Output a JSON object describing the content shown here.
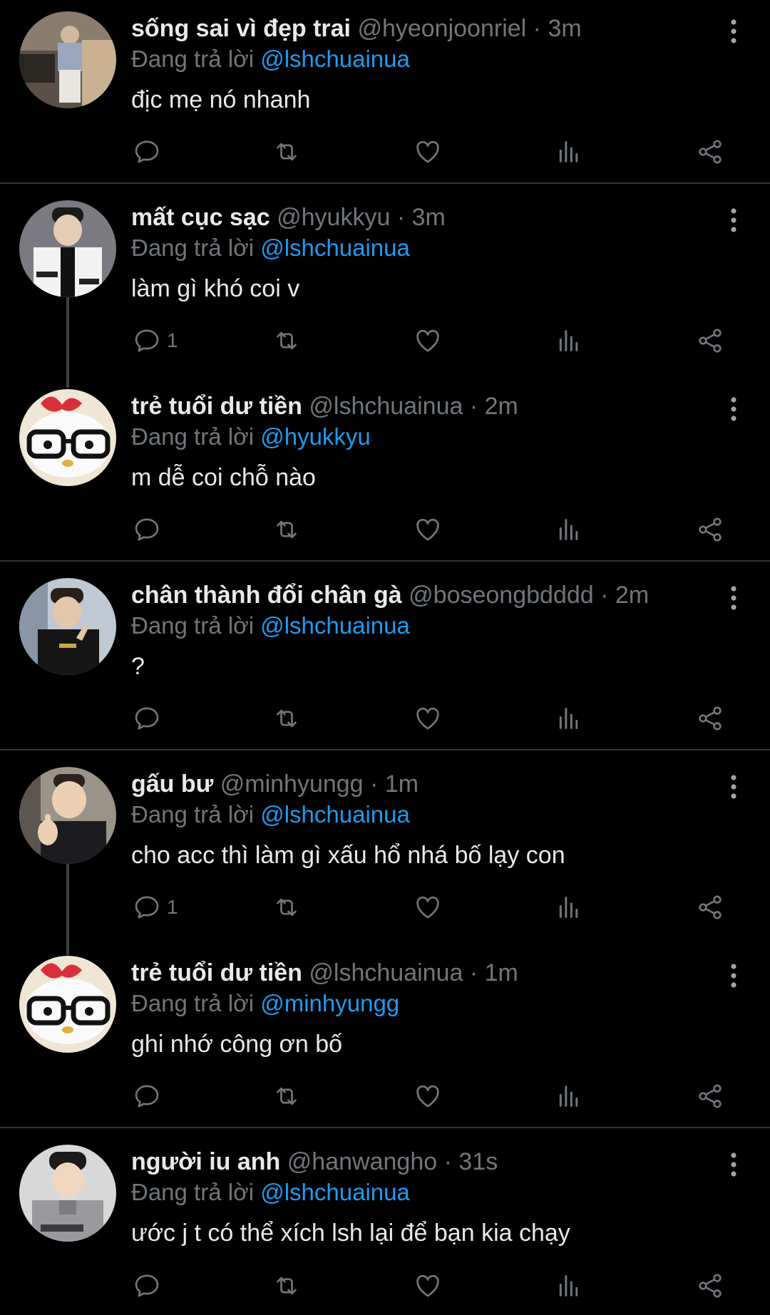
{
  "reply_prefix": "Đang trả lời",
  "tweets": [
    {
      "name": "sống sai vì đẹp trai",
      "handle": "@hyeonjoonriel",
      "time": "3m",
      "reply_to": "@lshchuainua",
      "text": "địc mẹ nó nhanh",
      "reply_count": ""
    },
    {
      "name": "mất cục sạc",
      "handle": "@hyukkyu",
      "time": "3m",
      "reply_to": "@lshchuainua",
      "text": "làm gì khó coi v",
      "reply_count": "1"
    },
    {
      "name": "trẻ tuổi dư tiền",
      "handle": "@lshchuainua",
      "time": "2m",
      "reply_to": "@hyukkyu",
      "text": "m dễ coi chỗ nào",
      "reply_count": ""
    },
    {
      "name": "chân thành đổi chân gà",
      "handle": "@boseongbdddd",
      "time": "2m",
      "reply_to": "@lshchuainua",
      "text": "?",
      "reply_count": ""
    },
    {
      "name": "gấu bư",
      "handle": "@minhyungg",
      "time": "1m",
      "reply_to": "@lshchuainua",
      "text": "cho acc thì làm gì xấu hổ nhá bố lạy con",
      "reply_count": "1"
    },
    {
      "name": "trẻ tuổi dư tiền",
      "handle": "@lshchuainua",
      "time": "1m",
      "reply_to": "@minhyungg",
      "text": "ghi nhớ công ơn bố",
      "reply_count": ""
    },
    {
      "name": "người iu anh",
      "handle": "@hanwangho",
      "time": "31s",
      "reply_to": "@lshchuainua",
      "text": "ước j t có thể xích lsh lại để bạn kia chạy",
      "reply_count": ""
    }
  ],
  "icons": {
    "reply": "reply-icon",
    "retweet": "retweet-icon",
    "like": "like-icon",
    "views": "views-icon",
    "share": "share-icon",
    "more": "more-options-icon"
  },
  "colors": {
    "background": "#000000",
    "text": "#e7e9ea",
    "muted": "#71767b",
    "mention": "#1d9bf0",
    "divider": "#2f3336"
  }
}
